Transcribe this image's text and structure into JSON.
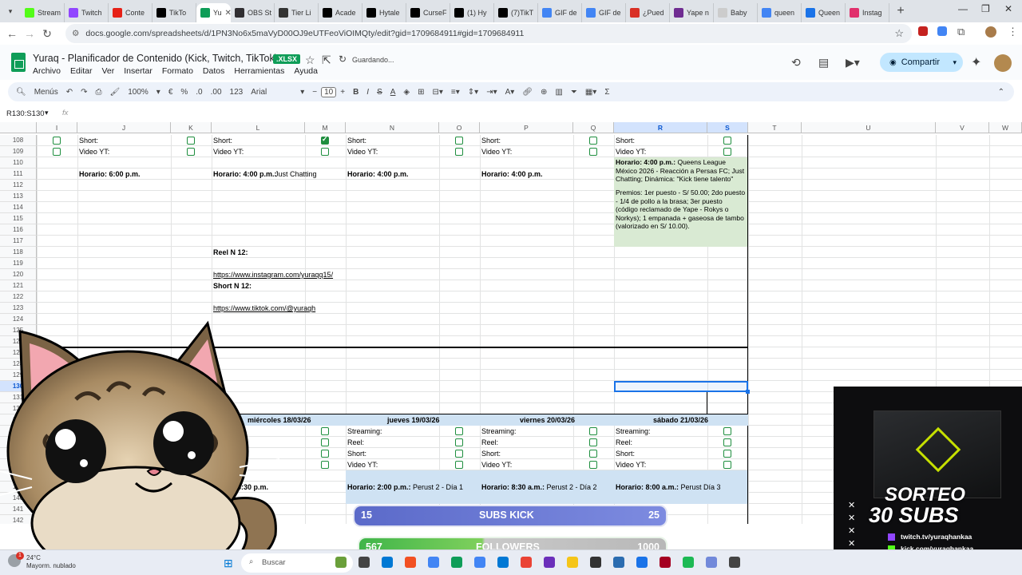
{
  "browser": {
    "tabs": [
      {
        "label": "Stream",
        "color": "#53fc18"
      },
      {
        "label": "Twitch",
        "color": "#9146ff"
      },
      {
        "label": "Conte",
        "color": "#e62117"
      },
      {
        "label": "TikTo",
        "color": "#000000"
      },
      {
        "label": "Yu",
        "color": "#0f9d58",
        "active": true
      },
      {
        "label": "OBS St",
        "color": "#302e31"
      },
      {
        "label": "Tier Li",
        "color": "#333333"
      },
      {
        "label": "Acade",
        "color": "#000000"
      },
      {
        "label": "Hytale",
        "color": "#000000"
      },
      {
        "label": "CurseF",
        "color": "#000000"
      },
      {
        "label": "(1) Hy",
        "color": "#000000"
      },
      {
        "label": "(7)TikT",
        "color": "#000000"
      },
      {
        "label": "GIF de",
        "color": "#4285f4"
      },
      {
        "label": "GIF de",
        "color": "#4285f4"
      },
      {
        "label": "¿Pued",
        "color": "#d93025"
      },
      {
        "label": "Yape n",
        "color": "#6f2c91"
      },
      {
        "label": "Baby",
        "color": "#cccccc"
      },
      {
        "label": "queen",
        "color": "#4285f4"
      },
      {
        "label": "Queen",
        "color": "#1a73e8"
      },
      {
        "label": "Instag",
        "color": "#e1306c"
      }
    ],
    "url": "docs.google.com/spreadsheets/d/1PN3No6x5maVyD00OJ9eUTFeoViOIMQty/edit?gid=1709684911#gid=1709684911"
  },
  "doc": {
    "title": "Yuraq - Planificador de Contenido (Kick, Twitch, TikTok)",
    "badge": ".XLSX",
    "saved": "Guardando...",
    "menus": [
      "Archivo",
      "Editar",
      "Ver",
      "Insertar",
      "Formato",
      "Datos",
      "Herramientas",
      "Ayuda"
    ],
    "share": "Compartir"
  },
  "toolbar": {
    "menus": "Menús",
    "zoom": "100%",
    "currency": "€",
    "percent": "%",
    "dec_less": ".0",
    "dec_more": ".00",
    "num": "123",
    "font": "Arial",
    "font_size": "10"
  },
  "formula": {
    "namebox": "R130:S130",
    "fx": "fx"
  },
  "columns": [
    "I",
    "J",
    "K",
    "L",
    "M",
    "N",
    "O",
    "P",
    "Q",
    "R",
    "S",
    "T",
    "U",
    "V",
    "W"
  ],
  "rows": [
    "108",
    "109",
    "110",
    "111",
    "112",
    "113",
    "114",
    "115",
    "116",
    "117",
    "118",
    "119",
    "120",
    "121",
    "122",
    "123",
    "124",
    "125",
    "126",
    "127",
    "128",
    "129",
    "130",
    "131",
    "132",
    "133",
    "134",
    "135",
    "136",
    "137",
    "138",
    "139",
    "140",
    "141",
    "142"
  ],
  "cells": {
    "short": "Short:",
    "video": "Video YT:",
    "streaming": "Streaming:",
    "reel": "Reel:",
    "j111": "Horario: 6:00 p.m.",
    "l111_b": "Horario: 4:00 p.m.:",
    "l111_r": " Just Chatting",
    "n111": "Horario: 4:00 p.m.",
    "p111": "Horario: 4:00 p.m.",
    "r110_b": "Horario: 4:00 p.m.:",
    "r110_r": " Queens League México 2026 - Reacción a Persas FC; Just Chatting; Dinámica: \"Kick tiene talento\"",
    "r113": "Premios: 1er puesto - S/ 50.00; 2do puesto - 1/4 de pollo a la brasa; 3er puesto (código reclamado de Yape - Rokys o Norkys); 1 empanada + gaseosa de tambo (valorizado en S/ 10.00).",
    "l118": "Reel N 12:",
    "l120": "https://www.instagram.com/yuraqq15/",
    "l121": "Short N 12:",
    "l123": "https://www.tiktok.com/@yuraqh",
    "d_mie": "miércoles 18/03/26",
    "d_jue": "jueves 19/03/26",
    "d_vie": "viernes 20/03/26",
    "d_sab": "sábado 21/03/26",
    "l139": "rio: 6:30 p.m.",
    "n139_b": "Horario: 2:00 p.m.:",
    "n139_r": " Perust 2 - Día 1",
    "p139_b": "Horario: 8:30 a.m.:",
    "p139_r": " Perust 2 - Día 2",
    "r139_b": "Horario: 8:00 a.m.:",
    "r139_r": " Perust Día 3"
  },
  "overlays": {
    "subs": {
      "label": "SUBS KICK",
      "current": "15",
      "goal": "25",
      "progress": 0.6
    },
    "followers": {
      "label": "FOLLOWERS",
      "current": "567",
      "goal": "1000",
      "progress": 0.567
    },
    "promo": {
      "line1": "SORTEO",
      "line2": "30 SUBS",
      "twitch": "twitch.tv/yuraqhankaa",
      "kick": "kick.com/yuraqhankaa"
    }
  },
  "taskbar": {
    "temp": "24°C",
    "weather": "Mayorm. nublado",
    "search": "Buscar"
  }
}
